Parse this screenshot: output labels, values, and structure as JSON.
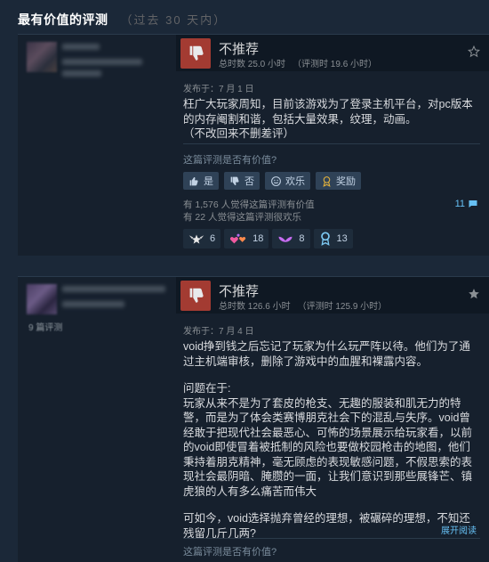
{
  "section": {
    "title": "最有价值的评测",
    "period": "（过去 30 天内）"
  },
  "reviews": [
    {
      "title": "不推荐",
      "hours_total": "总时数 25.0 小时",
      "hours_at_review": "（评测时 19.6 小时）",
      "posted": "发布于：7 月 1 日",
      "paragraphs": [
        "枉广大玩家周知，目前该游戏为了登录主机平台，对pc版本的内存阉割和谐，包括大量效果，纹理，动画。",
        "（不改回来不删差评）"
      ],
      "helpful_question": "这篇评测是否有价值?",
      "buttons": {
        "yes": "是",
        "no": "否",
        "funny": "欢乐",
        "award": "奖励"
      },
      "helpful_count": "有 1,576 人觉得这篇评测有价值",
      "funny_count": "有 22 人觉得这篇评测很欢乐",
      "comment_count": "11",
      "awards": [
        "6",
        "18",
        "8",
        "13"
      ]
    },
    {
      "title": "不推荐",
      "hours_total": "总时数 126.6 小时",
      "hours_at_review": "（评测时 125.9 小时）",
      "posted": "发布于：7 月 4 日",
      "review_count_label": "9 篇评测",
      "paragraphs": [
        "void挣到钱之后忘记了玩家为什么玩严阵以待。他们为了通过主机端审核，删除了游戏中的血腥和裸露内容。",
        "问题在于:\n玩家从来不是为了套皮的枪支、无趣的服装和肌无力的特警，而是为了体会类赛博朋克社会下的混乱与失序。void曾经敢于把现代社会最恶心、可怖的场景展示给玩家看，以前的void即使冒着被抵制的风险也要做校园枪击的地图，他们秉持着朋克精神，毫无顾虑的表现敏感问题，不假思索的表现社会最阴暗、腌臜的一面，让我们意识到那些展锋芒、镇虎狼的人有多么痛苦而伟大",
        "可如今，void选择抛弃曾经的理想，被碾碎的理想，不知还残留几斤几两?"
      ],
      "expand": "展开阅读",
      "helpful_question": "这篇评测是否有价值?"
    }
  ],
  "colors": {
    "background": "#1b2838",
    "thumb": "#a33b32",
    "link": "#66c0f4"
  }
}
